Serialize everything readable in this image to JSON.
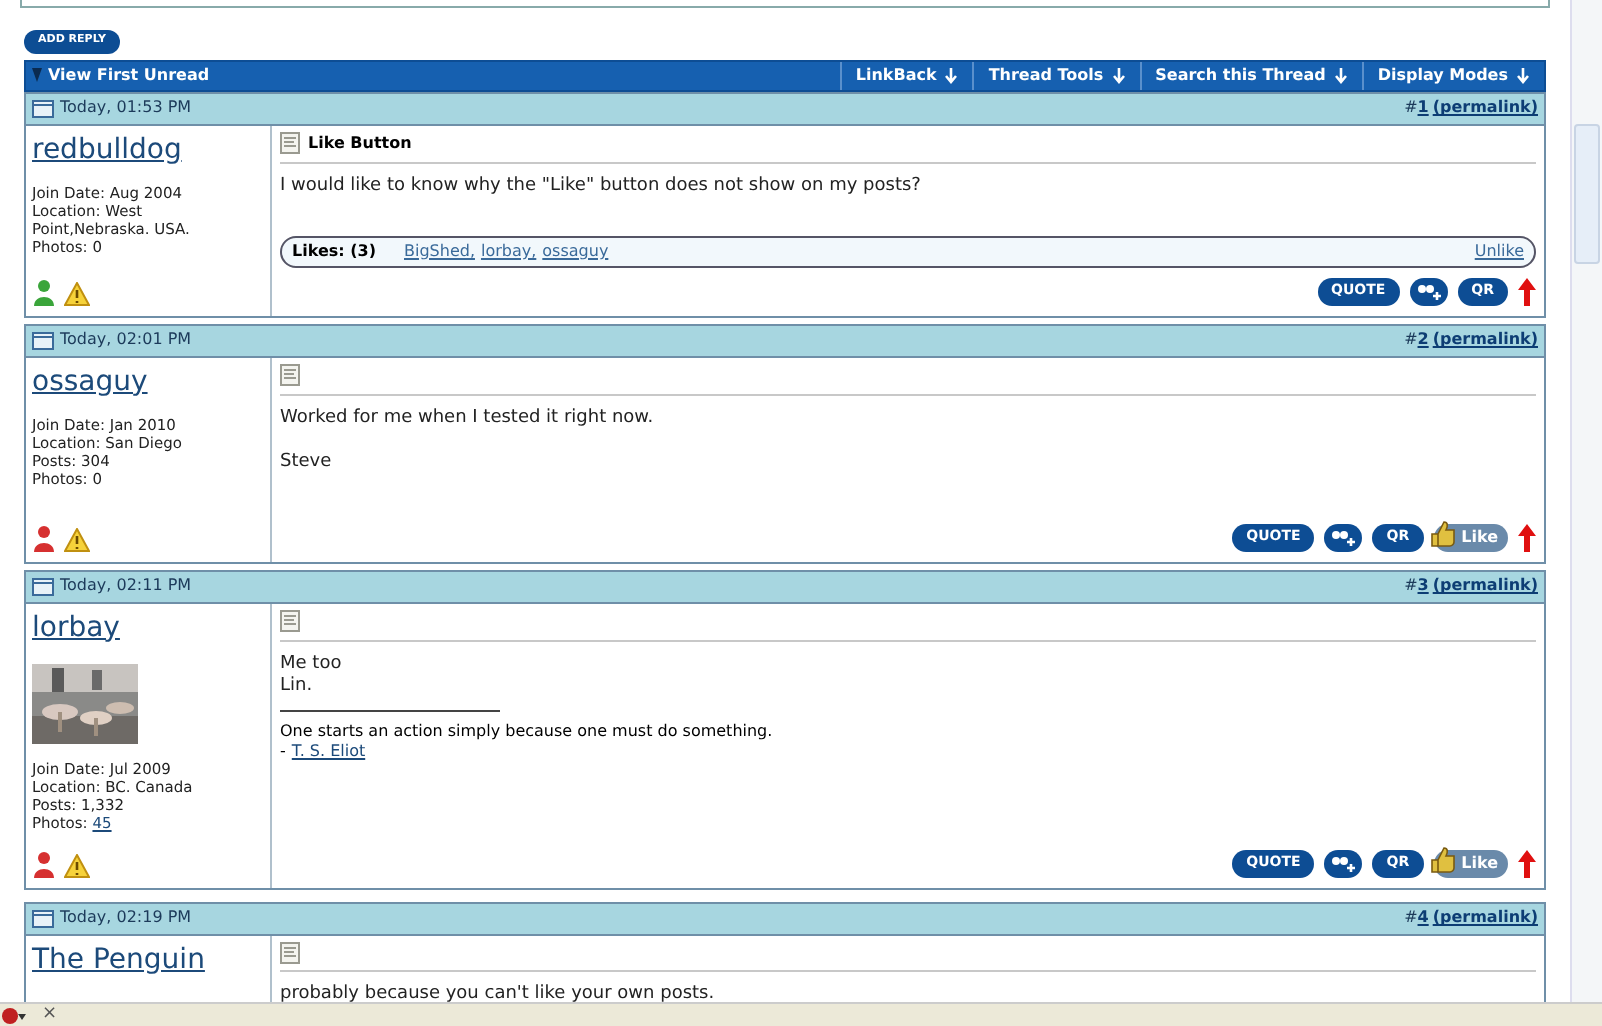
{
  "add_reply": "ADD REPLY",
  "header": {
    "title": "View First Unread",
    "menus": [
      "LinkBack",
      "Thread Tools",
      "Search this Thread",
      "Display Modes"
    ]
  },
  "posts": [
    {
      "date": "Today, 01:53 PM",
      "number_prefix": "#",
      "number": "1",
      "permalink": "(permalink)",
      "username": "redbulldog",
      "online": true,
      "info": [
        {
          "label": "Join Date:",
          "value": "Aug 2004",
          "link": false
        },
        {
          "label": "Location:",
          "value": "West Point,Nebraska. USA.",
          "link": false
        },
        {
          "label": "Photos:",
          "value": "0",
          "link": false
        }
      ],
      "title": "Like Button",
      "paragraphs": [
        [
          "I would like to know why the \"Like\" button does not show on my posts?"
        ]
      ],
      "likes": {
        "label": "Likes: (3)",
        "names": [
          "BigShed,",
          "lorbay,",
          "ossaguy"
        ],
        "unlike": "Unlike"
      },
      "actions": {
        "quote": "QUOTE",
        "qr": "QR"
      }
    },
    {
      "date": "Today, 02:01 PM",
      "number_prefix": "#",
      "number": "2",
      "permalink": "(permalink)",
      "username": "ossaguy",
      "online": false,
      "info": [
        {
          "label": "Join Date:",
          "value": "Jan 2010",
          "link": false
        },
        {
          "label": "Location:",
          "value": "San Diego",
          "link": false
        },
        {
          "label": "Posts:",
          "value": "304",
          "link": false
        },
        {
          "label": "Photos:",
          "value": "0",
          "link": false
        }
      ],
      "paragraphs": [
        [
          "Worked for me when I tested it right now."
        ],
        [
          "Steve"
        ]
      ],
      "actions": {
        "quote": "QUOTE",
        "qr": "QR",
        "like": "Like"
      }
    },
    {
      "date": "Today, 02:11 PM",
      "number_prefix": "#",
      "number": "3",
      "permalink": "(permalink)",
      "username": "lorbay",
      "online": false,
      "avatar": {
        "kind": "picture"
      },
      "info": [
        {
          "label": "Join Date:",
          "value": "Jul 2009",
          "link": false
        },
        {
          "label": "Location:",
          "value": "BC. Canada",
          "link": false
        },
        {
          "label": "Posts:",
          "value": "1,332",
          "link": false
        },
        {
          "label": "Photos:",
          "value": "45",
          "link": true
        }
      ],
      "paragraphs": [
        [
          "Me too",
          "Lin."
        ]
      ],
      "signature": {
        "quote": "One starts an action simply because one must do something.",
        "prefix": "-",
        "author": "T. S. Eliot"
      },
      "actions": {
        "quote": "QUOTE",
        "qr": "QR",
        "like": "Like"
      }
    },
    {
      "date": "Today, 02:19 PM",
      "number_prefix": "#",
      "number": "4",
      "permalink": "(permalink)",
      "username": "The Penguin",
      "paragraphs": [
        [
          "probably because you can't like your own posts."
        ]
      ]
    }
  ],
  "status_bar": {
    "close": "×"
  }
}
